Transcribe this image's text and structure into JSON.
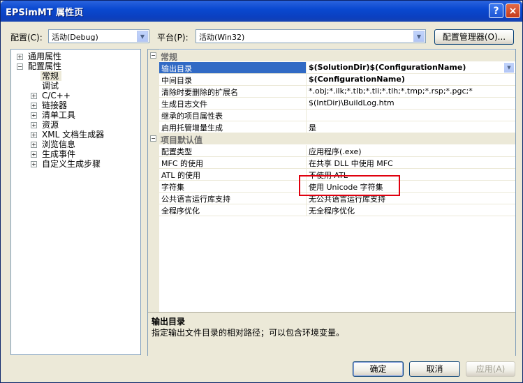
{
  "window": {
    "title": "EPSimMT 属性页"
  },
  "titlebar": {
    "help": "?",
    "close": "×"
  },
  "toolbar": {
    "config_label": "配置(C):",
    "config_value": "活动(Debug)",
    "platform_label": "平台(P):",
    "platform_value": "活动(Win32)",
    "config_manager_label": "配置管理器(O)..."
  },
  "tree": {
    "items": [
      {
        "label": "通用属性",
        "expander": "+"
      },
      {
        "label": "配置属性",
        "expander": "−"
      },
      {
        "label": "常规"
      },
      {
        "label": "调试"
      },
      {
        "label": "C/C++",
        "expander": "+"
      },
      {
        "label": "链接器",
        "expander": "+"
      },
      {
        "label": "清单工具",
        "expander": "+"
      },
      {
        "label": "资源",
        "expander": "+"
      },
      {
        "label": "XML 文档生成器",
        "expander": "+"
      },
      {
        "label": "浏览信息",
        "expander": "+"
      },
      {
        "label": "生成事件",
        "expander": "+"
      },
      {
        "label": "自定义生成步骤",
        "expander": "+"
      }
    ]
  },
  "grid": {
    "categories": [
      {
        "title": "常规",
        "props": [
          {
            "name": "输出目录",
            "value": "$(SolutionDir)$(ConfigurationName)"
          },
          {
            "name": "中间目录",
            "value": "$(ConfigurationName)"
          },
          {
            "name": "清除时要删除的扩展名",
            "value": "*.obj;*.ilk;*.tlb;*.tli;*.tlh;*.tmp;*.rsp;*.pgc;*"
          },
          {
            "name": "生成日志文件",
            "value": "$(IntDir)\\BuildLog.htm"
          },
          {
            "name": "继承的项目属性表",
            "value": ""
          },
          {
            "name": "启用托管增量生成",
            "value": "是"
          }
        ]
      },
      {
        "title": "项目默认值",
        "props": [
          {
            "name": "配置类型",
            "value": "应用程序(.exe)"
          },
          {
            "name": "MFC 的使用",
            "value": "在共享 DLL 中使用 MFC"
          },
          {
            "name": "ATL 的使用",
            "value": "不使用 ATL"
          },
          {
            "name": "字符集",
            "value": "使用 Unicode 字符集"
          },
          {
            "name": "公共语言运行库支持",
            "value": "无公共语言运行库支持"
          },
          {
            "name": "全程序优化",
            "value": "无全程序优化"
          }
        ]
      }
    ],
    "cat_expander": "−",
    "combo_arrow": "▼"
  },
  "description": {
    "title": "输出目录",
    "text": "指定输出文件目录的相对路径；可以包含环境变量。"
  },
  "buttons": {
    "ok": "确定",
    "cancel": "取消",
    "apply": "应用(A)"
  },
  "colors": {
    "highlight": "#316ac5",
    "annotation": "#e0000e"
  }
}
